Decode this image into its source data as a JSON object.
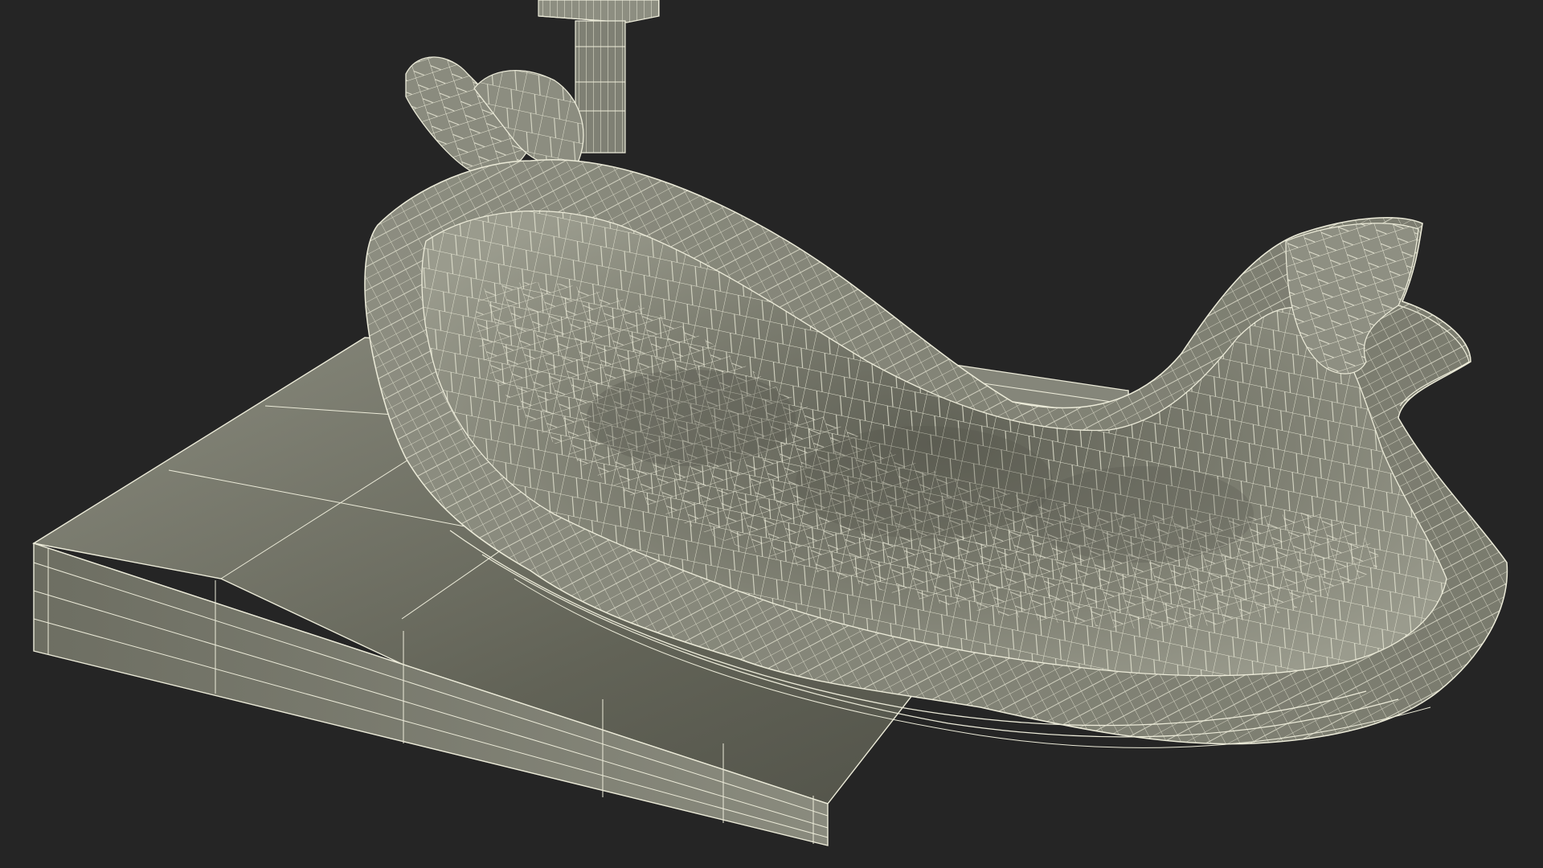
{
  "scene": {
    "background_color": "#252525",
    "surface_color": "#7c7d70",
    "wire_color": "#ecebd9",
    "shadow_color": "#55554c",
    "objects": [
      "base-plate",
      "upright-post",
      "impression-tray",
      "tray-handle"
    ]
  }
}
